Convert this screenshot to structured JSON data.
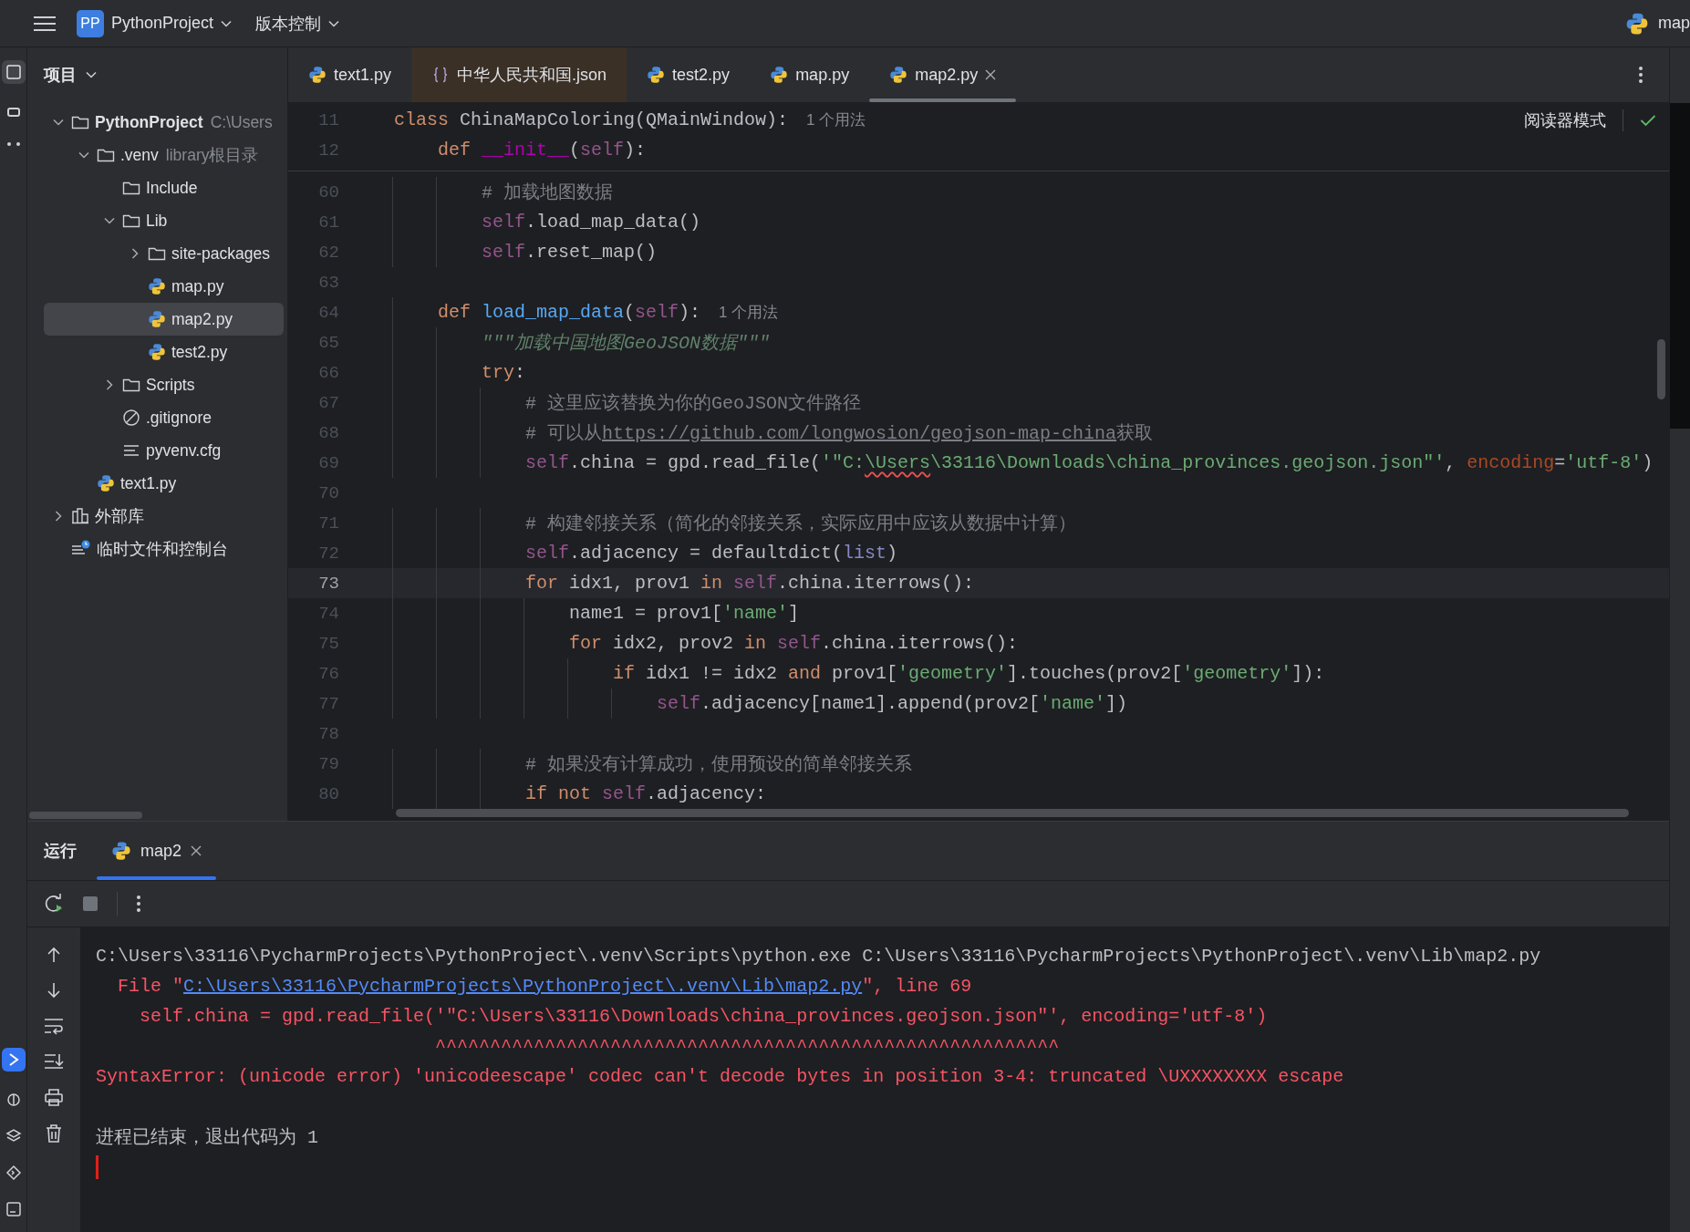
{
  "title_bar": {
    "project_badge": "PP",
    "project": "PythonProject",
    "vcs": "版本控制",
    "run_config": "map"
  },
  "project_panel": {
    "title": "项目",
    "tree": [
      {
        "label": "PythonProject",
        "hint": "C:\\Users",
        "kind": "project",
        "expanded": true,
        "selected": false,
        "children": [
          {
            "label": ".venv",
            "hint": "library根目录",
            "kind": "folder",
            "expanded": true,
            "selected": false,
            "children": [
              {
                "label": "Include",
                "kind": "folder",
                "selected": false
              },
              {
                "label": "Lib",
                "kind": "folder",
                "expanded": true,
                "selected": false,
                "children": [
                  {
                    "label": "site-packages",
                    "kind": "folder",
                    "expanded": false,
                    "selected": false
                  },
                  {
                    "label": "map.py",
                    "kind": "python",
                    "selected": false
                  },
                  {
                    "label": "map2.py",
                    "kind": "python",
                    "selected": true
                  },
                  {
                    "label": "test2.py",
                    "kind": "python",
                    "selected": false
                  }
                ]
              },
              {
                "label": "Scripts",
                "kind": "folder",
                "expanded": false,
                "selected": false
              },
              {
                "label": ".gitignore",
                "kind": "ignore",
                "selected": false
              },
              {
                "label": "pyvenv.cfg",
                "kind": "config",
                "selected": false
              }
            ]
          },
          {
            "label": "text1.py",
            "kind": "python",
            "selected": false
          }
        ]
      },
      {
        "label": "外部库",
        "kind": "library",
        "expanded": false,
        "selected": false
      },
      {
        "label": "临时文件和控制台",
        "kind": "scratch",
        "selected": false
      }
    ]
  },
  "editor": {
    "tabs": [
      {
        "label": "text1.py",
        "kind": "python",
        "selected": false,
        "tinted": false
      },
      {
        "label": "中华人民共和国.json",
        "kind": "json",
        "selected": false,
        "tinted": true
      },
      {
        "label": "test2.py",
        "kind": "python",
        "selected": false,
        "tinted": false
      },
      {
        "label": "map.py",
        "kind": "python",
        "selected": false,
        "tinted": false
      },
      {
        "label": "map2.py",
        "kind": "python",
        "selected": true,
        "tinted": false
      }
    ],
    "reader_mode": "阅读器模式",
    "sticky_lines": [
      {
        "number": "11",
        "tokens": [
          {
            "kind": "kw",
            "text": "class "
          },
          {
            "kind": "plain",
            "text": "ChinaMapColoring(QMainWindow):"
          }
        ],
        "hint": "1 个用法"
      },
      {
        "number": "12",
        "tokens": [
          {
            "kind": "kw",
            "text": "    def "
          },
          {
            "kind": "magic",
            "text": "__init__"
          },
          {
            "kind": "plain",
            "text": "("
          },
          {
            "kind": "self",
            "text": "self"
          },
          {
            "kind": "plain",
            "text": "):"
          }
        ]
      }
    ],
    "lines": [
      {
        "number": "60",
        "tokens": [
          {
            "kind": "cmt",
            "text": "        # 加载地图数据"
          }
        ],
        "current": false
      },
      {
        "number": "61",
        "tokens": [
          {
            "kind": "self",
            "text": "        self"
          },
          {
            "kind": "plain",
            "text": ".load_map_data()"
          }
        ],
        "current": false
      },
      {
        "number": "62",
        "tokens": [
          {
            "kind": "self",
            "text": "        self"
          },
          {
            "kind": "plain",
            "text": ".reset_map()"
          }
        ],
        "current": false
      },
      {
        "number": "63",
        "current": false
      },
      {
        "number": "64",
        "tokens": [
          {
            "kind": "kw",
            "text": "    def "
          },
          {
            "kind": "fn",
            "text": "load_map_data"
          },
          {
            "kind": "plain",
            "text": "("
          },
          {
            "kind": "self",
            "text": "self"
          },
          {
            "kind": "plain",
            "text": "):"
          }
        ],
        "hint": "1 个用法",
        "current": false
      },
      {
        "number": "65",
        "tokens": [
          {
            "kind": "doc",
            "text": "        \"\"\"加载中国地图GeoJSON数据\"\"\""
          }
        ],
        "current": false
      },
      {
        "number": "66",
        "tokens": [
          {
            "kind": "kw",
            "text": "        try"
          },
          {
            "kind": "plain",
            "text": ":"
          }
        ],
        "current": false
      },
      {
        "number": "67",
        "tokens": [
          {
            "kind": "cmt",
            "text": "            # 这里应该替换为你的GeoJSON文件路径"
          }
        ],
        "current": false
      },
      {
        "number": "68",
        "tokens": [
          {
            "kind": "cmt",
            "text": "            # 可以从"
          },
          {
            "kind": "link",
            "text": "https://github.com/longwosion/geojson-map-china"
          },
          {
            "kind": "cmt",
            "text": "获取"
          }
        ],
        "current": false
      },
      {
        "number": "69",
        "tokens": [
          {
            "kind": "self",
            "text": "            self"
          },
          {
            "kind": "plain",
            "text": ".china = gpd.read_file("
          },
          {
            "kind": "str",
            "text": "'\"C:"
          },
          {
            "kind": "typo",
            "text": "\\Users"
          },
          {
            "kind": "str",
            "text": "\\33116\\Downloads\\china_provinces.geojson.json\"'"
          },
          {
            "kind": "plain",
            "text": ", "
          },
          {
            "kind": "param",
            "text": "encoding"
          },
          {
            "kind": "plain",
            "text": "="
          },
          {
            "kind": "str",
            "text": "'utf-8'"
          },
          {
            "kind": "plain",
            "text": ")"
          }
        ],
        "current": false
      },
      {
        "number": "70",
        "current": false
      },
      {
        "number": "71",
        "tokens": [
          {
            "kind": "cmt",
            "text": "            # 构建邻接关系（简化的邻接关系，实际应用中应该从数据中计算）"
          }
        ],
        "current": false
      },
      {
        "number": "72",
        "tokens": [
          {
            "kind": "self",
            "text": "            self"
          },
          {
            "kind": "plain",
            "text": ".adjacency = defaultdict("
          },
          {
            "kind": "builtin",
            "text": "list"
          },
          {
            "kind": "plain",
            "text": ")"
          }
        ],
        "current": false
      },
      {
        "number": "73",
        "tokens": [
          {
            "kind": "kw",
            "text": "            for "
          },
          {
            "kind": "plain",
            "text": "idx1, prov1 "
          },
          {
            "kind": "kw",
            "text": "in "
          },
          {
            "kind": "self",
            "text": "self"
          },
          {
            "kind": "plain",
            "text": ".china.iterrows():"
          }
        ],
        "current": true
      },
      {
        "number": "74",
        "tokens": [
          {
            "kind": "plain",
            "text": "                name1 = prov1["
          },
          {
            "kind": "str",
            "text": "'name'"
          },
          {
            "kind": "plain",
            "text": "]"
          }
        ],
        "current": false
      },
      {
        "number": "75",
        "tokens": [
          {
            "kind": "kw",
            "text": "                for "
          },
          {
            "kind": "plain",
            "text": "idx2, prov2 "
          },
          {
            "kind": "kw",
            "text": "in "
          },
          {
            "kind": "self",
            "text": "self"
          },
          {
            "kind": "plain",
            "text": ".china.iterrows():"
          }
        ],
        "current": false
      },
      {
        "number": "76",
        "tokens": [
          {
            "kind": "kw",
            "text": "                    if "
          },
          {
            "kind": "plain",
            "text": "idx1 != idx2 "
          },
          {
            "kind": "kw",
            "text": "and "
          },
          {
            "kind": "plain",
            "text": "prov1["
          },
          {
            "kind": "str",
            "text": "'geometry'"
          },
          {
            "kind": "plain",
            "text": "].touches(prov2["
          },
          {
            "kind": "str",
            "text": "'geometry'"
          },
          {
            "kind": "plain",
            "text": "]):"
          }
        ],
        "current": false
      },
      {
        "number": "77",
        "tokens": [
          {
            "kind": "self",
            "text": "                        self"
          },
          {
            "kind": "plain",
            "text": ".adjacency[name1].append(prov2["
          },
          {
            "kind": "str",
            "text": "'name'"
          },
          {
            "kind": "plain",
            "text": "])"
          }
        ],
        "current": false
      },
      {
        "number": "78",
        "current": false
      },
      {
        "number": "79",
        "tokens": [
          {
            "kind": "cmt",
            "text": "            # 如果没有计算成功，使用预设的简单邻接关系"
          }
        ],
        "current": false
      },
      {
        "number": "80",
        "tokens": [
          {
            "kind": "kw",
            "text": "            if not "
          },
          {
            "kind": "self",
            "text": "self"
          },
          {
            "kind": "plain",
            "text": ".adjacency:"
          }
        ],
        "current": false
      }
    ]
  },
  "run_panel": {
    "title": "运行",
    "tabs": [
      {
        "label": "map2",
        "selected": true
      }
    ],
    "output": [
      {
        "kind": "command",
        "text": "C:\\Users\\33116\\PycharmProjects\\PythonProject\\.venv\\Scripts\\python.exe C:\\Users\\33116\\PycharmProjects\\PythonProject\\.venv\\Lib\\map2.py"
      },
      {
        "kind": "error",
        "text": "  File \"",
        "link": "C:\\Users\\33116\\PycharmProjects\\PythonProject\\.venv\\Lib\\map2.py",
        "after": "\", line 69"
      },
      {
        "kind": "error",
        "text": "    self.china = gpd.read_file('\"C:\\Users\\33116\\Downloads\\china_provinces.geojson.json\"', encoding='utf-8')"
      },
      {
        "kind": "error",
        "text": "                               ^^^^^^^^^^^^^^^^^^^^^^^^^^^^^^^^^^^^^^^^^^^^^^^^^^^^^^^^^"
      },
      {
        "kind": "error",
        "text": "SyntaxError: (unicode error) 'unicodeescape' codec can't decode bytes in position 3-4: truncated \\UXXXXXXXX escape"
      },
      {
        "kind": "blank"
      },
      {
        "kind": "command",
        "text": "进程已结束，退出代码为 1"
      }
    ]
  }
}
